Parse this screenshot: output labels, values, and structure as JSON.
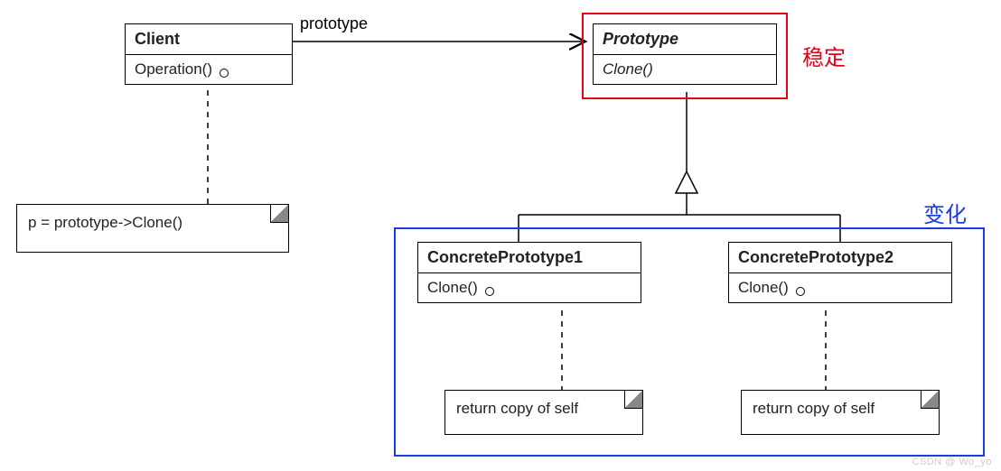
{
  "client": {
    "name": "Client",
    "op": "Operation()"
  },
  "prototype": {
    "name": "Prototype",
    "op": "Clone()"
  },
  "concrete1": {
    "name": "ConcretePrototype1",
    "op": "Clone()"
  },
  "concrete2": {
    "name": "ConcretePrototype2",
    "op": "Clone()"
  },
  "note_client": "p = prototype->Clone()",
  "note_concrete1": "return copy of self",
  "note_concrete2": "return copy of self",
  "assoc_label": "prototype",
  "label_stable": "稳定",
  "label_change": "变化",
  "watermark": "CSDN @ Wo_yo"
}
